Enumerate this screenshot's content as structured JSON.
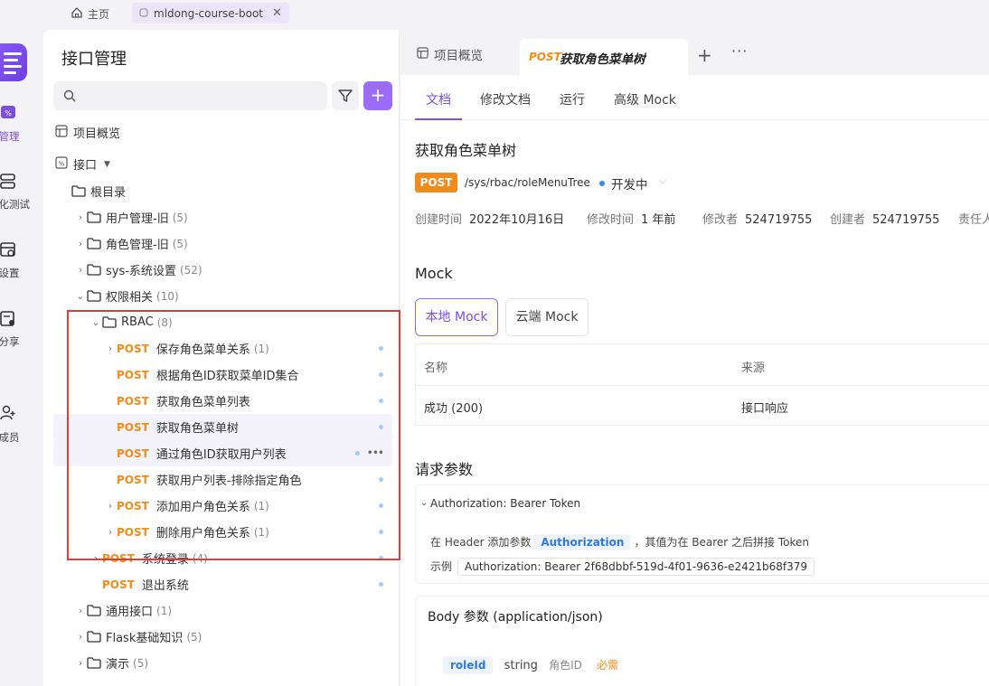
{
  "topbar": {
    "home_label": "主页",
    "project_tab": "mldong-course-boot",
    "close_glyph": "✕"
  },
  "rail": {
    "items": [
      {
        "label": "口管理",
        "icon": "api-icon",
        "color": "#7c4dde"
      },
      {
        "label": "动化测试",
        "icon": "test-icon",
        "color": "#333"
      },
      {
        "label": "目设置",
        "icon": "settings-icon",
        "color": "#333"
      },
      {
        "label": "线分享",
        "icon": "share-icon",
        "color": "#333"
      },
      {
        "label": "请成员",
        "icon": "invite-icon",
        "color": "#333"
      }
    ]
  },
  "sidebar": {
    "title": "接口管理",
    "search_placeholder": "",
    "add_label": "+",
    "overview_label": "项目概览",
    "api_root_label": "接口",
    "tree": [
      {
        "level": 0,
        "chev": "",
        "type": "folder",
        "label": "根目录",
        "count": ""
      },
      {
        "level": 1,
        "chev": "›",
        "type": "folder",
        "label": "用户管理-旧",
        "count": "(5)"
      },
      {
        "level": 1,
        "chev": "›",
        "type": "folder",
        "label": "角色管理-旧",
        "count": "(5)"
      },
      {
        "level": 1,
        "chev": "›",
        "type": "folder",
        "label": "sys-系统设置",
        "count": "(52)"
      },
      {
        "level": 1,
        "chev": "⌄",
        "type": "folder",
        "label": "权限相关",
        "count": "(10)"
      },
      {
        "level": 2,
        "chev": "⌄",
        "type": "folder",
        "label": "RBAC",
        "count": "(8)"
      },
      {
        "level": 3,
        "chev": "›",
        "type": "api",
        "method": "POST",
        "label": "保存角色菜单关系",
        "count": "(1)",
        "dot": true
      },
      {
        "level": 3,
        "chev": "",
        "type": "api",
        "method": "POST",
        "label": "根据角色ID获取菜单ID集合",
        "count": "",
        "dot": true
      },
      {
        "level": 3,
        "chev": "",
        "type": "api",
        "method": "POST",
        "label": "获取角色菜单列表",
        "count": "",
        "dot": true
      },
      {
        "level": 3,
        "chev": "",
        "type": "api",
        "method": "POST",
        "label": "获取角色菜单树",
        "count": "",
        "dot": true,
        "selected": true
      },
      {
        "level": 3,
        "chev": "",
        "type": "api",
        "method": "POST",
        "label": "通过角色ID获取用户列表",
        "count": "",
        "dot": true,
        "hover": true,
        "more": "•••"
      },
      {
        "level": 3,
        "chev": "",
        "type": "api",
        "method": "POST",
        "label": "获取用户列表-排除指定角色",
        "count": "",
        "dot": true
      },
      {
        "level": 3,
        "chev": "›",
        "type": "api",
        "method": "POST",
        "label": "添加用户角色关系",
        "count": "(1)",
        "dot": true
      },
      {
        "level": 3,
        "chev": "›",
        "type": "api",
        "method": "POST",
        "label": "删除用户角色关系",
        "count": "(1)",
        "dot": true
      },
      {
        "level": 2,
        "chev": "›",
        "type": "api",
        "method": "POST",
        "label": "系统登录",
        "count": "(4)",
        "dot": true
      },
      {
        "level": 2,
        "chev": "",
        "type": "api",
        "method": "POST",
        "label": "退出系统",
        "count": "",
        "dot": true
      },
      {
        "level": 1,
        "chev": "›",
        "type": "folder",
        "label": "通用接口",
        "count": "(1)"
      },
      {
        "level": 1,
        "chev": "›",
        "type": "folder",
        "label": "Flask基础知识",
        "count": "(5)"
      },
      {
        "level": 1,
        "chev": "›",
        "type": "folder",
        "label": "演示",
        "count": "(5)"
      }
    ]
  },
  "main": {
    "tab_overview": "项目概览",
    "tab_active_method": "POST",
    "tab_active_title": "获取角色菜单树",
    "tab_add": "+",
    "tab_more": "···",
    "subtabs": [
      "文档",
      "修改文档",
      "运行",
      "高级 Mock"
    ],
    "api": {
      "title": "获取角色菜单树",
      "method": "POST",
      "path": "/sys/rbac/roleMenuTree",
      "status": "开发中",
      "status_color": "#2f8cf0",
      "meta": [
        {
          "k": "创建时间",
          "v": "2022年10月16日"
        },
        {
          "k": "修改时间",
          "v": "1 年前"
        },
        {
          "k": "修改者",
          "v": "524719755"
        },
        {
          "k": "创建者",
          "v": "524719755"
        },
        {
          "k": "责任人",
          "v": ""
        }
      ]
    },
    "mock": {
      "title": "Mock",
      "local": "本地 Mock",
      "cloud": "云端 Mock",
      "col_name": "名称",
      "col_source": "来源",
      "row_name": "成功 (200)",
      "row_source": "接口响应"
    },
    "params": {
      "title": "请求参数",
      "auth_header": "Authorization: Bearer Token",
      "auth_desc_pre": "在 Header 添加参数",
      "auth_keyword": "Authorization",
      "auth_desc_post": "，其值为在 Bearer 之后拼接 Token",
      "example_label": "示例",
      "example_value": "Authorization: Bearer 2f68dbbf-519d-4f01-9636-e2421b68f379",
      "body_title": "Body 参数 (application/json)",
      "param_name": "roleId",
      "param_type": "string",
      "param_desc": "角色ID",
      "param_required": "必需"
    }
  },
  "colors": {
    "accent": "#7c4dde",
    "post": "#f08c1a",
    "highlight_box": "#e63a3a"
  }
}
